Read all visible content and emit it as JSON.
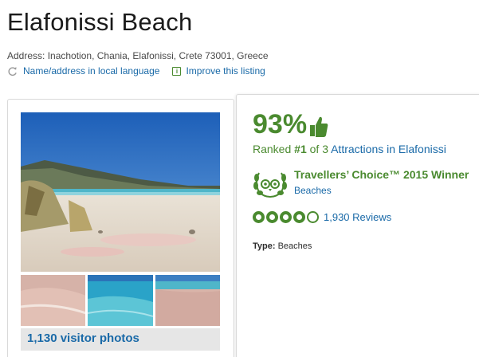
{
  "title": "Elafonissi Beach",
  "address": "Address: Inachotion, Chania, Elafonissi, Crete 73001, Greece",
  "links": {
    "local_language": "Name/address in local language",
    "improve": "Improve this listing",
    "info_glyph": "i"
  },
  "photos": {
    "count_label": "1,130 visitor photos"
  },
  "rating": {
    "percent": "93%",
    "rank_prefix": "Ranked ",
    "rank": "#1",
    "rank_of": " of 3 ",
    "rank_link": "Attractions in Elafonissi"
  },
  "award": {
    "title": "Travellers’ Choice™ 2015 Winner",
    "category": "Beaches"
  },
  "reviews": {
    "bubbles": 4.5,
    "count_label": "1,930 Reviews"
  },
  "type": {
    "label": "Type:",
    "value": " Beaches"
  },
  "colors": {
    "brand_green": "#4a8a2f",
    "link_blue": "#1a6aa8"
  }
}
